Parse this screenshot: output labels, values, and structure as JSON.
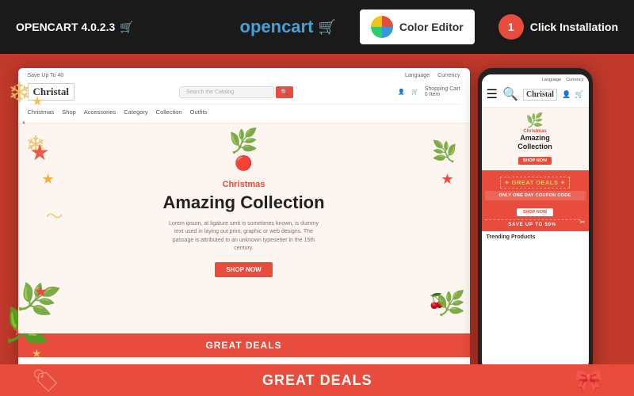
{
  "topbar": {
    "version": "OPENCART 4.0.2.3",
    "cart_icon": "🛒",
    "opencart_label": "opencart",
    "cart_symbol": "🛒",
    "color_editor_label": "Color Editor",
    "one_click_num": "1",
    "one_click_label": "Click Installation"
  },
  "store": {
    "save_label": "Save Up To 40",
    "language_label": "Language",
    "currency_label": "Currency",
    "logo": "Christal",
    "search_placeholder": "Search the Catalog",
    "cart_label": "Shopping Cart",
    "cart_items": "0 Item",
    "nav_items": [
      "Christmas",
      "Shop",
      "Accessories",
      "Category",
      "Collection",
      "Outfits"
    ],
    "hero_subtitle": "Christmas",
    "hero_title": "Amazing Collection",
    "hero_desc": "Lorem ipsum, at ligature serit is sometimes known, is dummy text used in laying out print, graphic or web designs. The passage is attributed to an unknown typesetter in the 15th century.",
    "shop_now": "SHOP NOW",
    "great_deals": "GREAT DEALS"
  },
  "mobile": {
    "language": "Language",
    "currency": "Currency",
    "logo": "Christal",
    "hero_subtitle": "Christmas",
    "hero_title_line1": "Amazing",
    "hero_title_line2": "Collection",
    "shop_now": "SHOP NOW",
    "deals_title": "GREAT DEALS",
    "coupon_text": "ONLY ONE DAY COUPON CODE",
    "shop_btn": "SHOP NOW",
    "save_text": "SAVE UP TO 50%",
    "trending_title": "Trending Products"
  },
  "bottom": {
    "great_deals": "GREAT DEALS"
  }
}
